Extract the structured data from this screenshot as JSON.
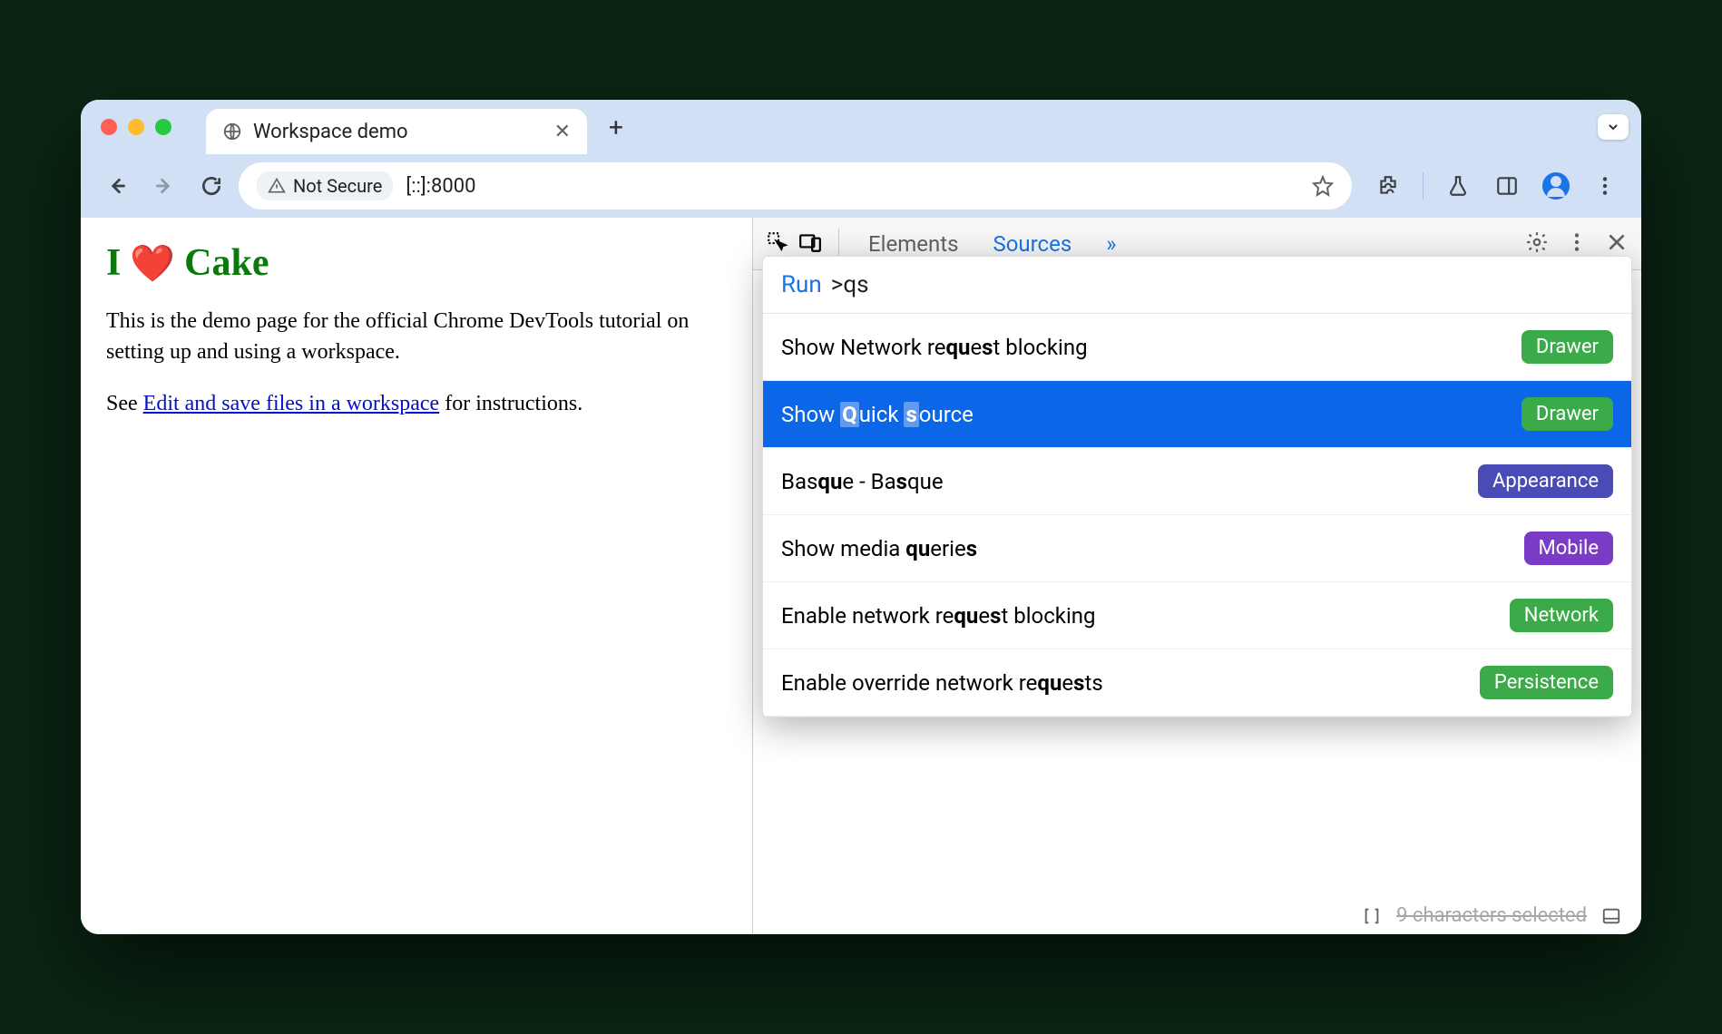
{
  "browser": {
    "tab_title": "Workspace demo",
    "security_label": "Not Secure",
    "url": "[::]:8000"
  },
  "page": {
    "heading_prefix": "I",
    "heading_heart": "❤️",
    "heading_suffix": "Cake",
    "paragraph": "This is the demo page for the official Chrome DevTools tutorial on setting up and using a workspace.",
    "see_prefix": "See ",
    "link_text": "Edit and save files in a workspace",
    "see_suffix": " for instructions."
  },
  "devtools": {
    "tabs": {
      "elements": "Elements",
      "sources": "Sources",
      "more": "»"
    },
    "footer_text": "9 characters selected"
  },
  "cmd": {
    "run_label": "Run",
    "query_prefix": ">",
    "query": "qs",
    "items": [
      {
        "pre": "Show Network re",
        "b1": "qu",
        "mid1": "e",
        "b2": "s",
        "mid2": "t blocking",
        "badge": "Drawer",
        "badge_cls": "green",
        "sel": false,
        "is_quick": false
      },
      {
        "pre": "Show ",
        "Q": "Q",
        "mid1": "uick ",
        "S": "s",
        "mid2": "ource",
        "badge": "Drawer",
        "badge_cls": "green",
        "sel": true,
        "is_quick": true
      },
      {
        "pre": "Bas",
        "b1": "qu",
        "mid1": "e - Ba",
        "b2": "s",
        "mid2": "que",
        "badge": "Appearance",
        "badge_cls": "indigo",
        "sel": false,
        "is_quick": false
      },
      {
        "pre": "Show media ",
        "b1": "qu",
        "mid1": "erie",
        "b2": "s",
        "mid2": "",
        "badge": "Mobile",
        "badge_cls": "purple",
        "sel": false,
        "is_quick": false
      },
      {
        "pre": "Enable network re",
        "b1": "qu",
        "mid1": "e",
        "b2": "s",
        "mid2": "t blocking",
        "badge": "Network",
        "badge_cls": "green",
        "sel": false,
        "is_quick": false
      },
      {
        "pre": "Enable override network re",
        "b1": "qu",
        "mid1": "e",
        "b2": "s",
        "mid2": "ts",
        "badge": "Persistence",
        "badge_cls": "green",
        "sel": false,
        "is_quick": false
      }
    ]
  }
}
